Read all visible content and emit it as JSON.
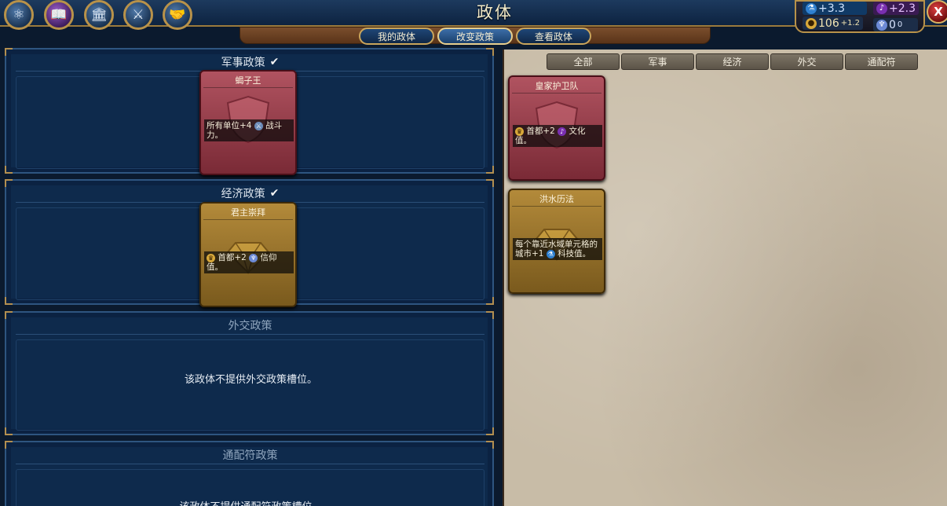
{
  "title": "政体",
  "advisors": [
    {
      "name": "science",
      "icon": "atom-icon"
    },
    {
      "name": "culture",
      "icon": "book-icon"
    },
    {
      "name": "capital",
      "icon": "capitol-icon"
    },
    {
      "name": "military",
      "icon": "helmet-icon"
    },
    {
      "name": "trade",
      "icon": "handshake-icon"
    }
  ],
  "tabs": {
    "my_government": "我的政体",
    "change_policies": "改变政策",
    "view_government": "查看政体"
  },
  "resources": {
    "science": "+3.3",
    "culture": "+2.3",
    "gold": "106",
    "gold_delta": "+1.2",
    "faith": "0",
    "faith_delta": "0"
  },
  "close_label": "X",
  "categories": {
    "military": {
      "title": "军事政策",
      "filled": true
    },
    "economic": {
      "title": "经济政策",
      "filled": true
    },
    "diplomatic": {
      "title": "外交政策",
      "message": "该政体不提供外交政策槽位。"
    },
    "wildcard": {
      "title": "通配符政策",
      "message": "该政体不提供通配符政策槽位。"
    }
  },
  "slotted_cards": {
    "military": {
      "name": "蝎子王",
      "effect_a": "所有单位+4",
      "effect_b": "战斗力。"
    },
    "economic": {
      "name": "君主崇拜",
      "effect_a": "首都+2",
      "effect_b": "信仰值。"
    }
  },
  "filters": [
    "全部",
    "军事",
    "经济",
    "外交",
    "通配符"
  ],
  "library": [
    {
      "name": "皇家护卫队",
      "type": "military",
      "effect_a": "首都+2",
      "effect_b": "文化值。"
    },
    {
      "name": "洪水历法",
      "type": "economic",
      "effect_a": "每个靠近水域单元格的城市+1",
      "effect_b": "科技值。"
    }
  ],
  "colors": {
    "military_card": "#9a3f4c",
    "economic_card": "#9c7430",
    "panel_blue": "#0e2a4c",
    "parchment": "#c8bca7",
    "gold_trim": "#b8924a"
  }
}
